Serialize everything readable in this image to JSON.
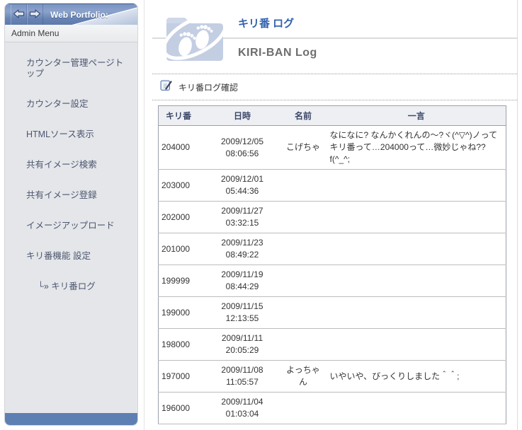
{
  "sidebar": {
    "title": "Web Portfolio:",
    "section_label": "Admin Menu",
    "back_icon": "back-arrow-icon",
    "forward_icon": "forward-arrow-icon",
    "items": [
      {
        "label": "カウンター管理ページトップ",
        "sub": false
      },
      {
        "label": "カウンター設定",
        "sub": false
      },
      {
        "label": "HTMLソース表示",
        "sub": false
      },
      {
        "label": "共有イメージ検索",
        "sub": false
      },
      {
        "label": "共有イメージ登録",
        "sub": false
      },
      {
        "label": "イメージアップロード",
        "sub": false
      },
      {
        "label": "キリ番機能 設定",
        "sub": false
      },
      {
        "label": "キリ番ログ",
        "sub": true,
        "prefix": "└» "
      }
    ]
  },
  "header": {
    "title_jp": "キリ番 ログ",
    "title_en": "KIRI-BAN Log",
    "icon": "footprints-folder-icon"
  },
  "section": {
    "label": "キリ番ログ確認",
    "icon": "log-note-icon"
  },
  "table": {
    "columns": [
      "キリ番",
      "日時",
      "名前",
      "一言"
    ],
    "rows": [
      {
        "kiriban": "204000",
        "date": "2009/12/05",
        "time": "08:06:56",
        "name": "こげちゃ",
        "comment": "なになに? なんかくれんの〜?ヾ(^▽^)ノってキリ番って…204000って…微妙じゃね??f(^_^;"
      },
      {
        "kiriban": "203000",
        "date": "2009/12/01",
        "time": "05:44:36",
        "name": "",
        "comment": ""
      },
      {
        "kiriban": "202000",
        "date": "2009/11/27",
        "time": "03:32:15",
        "name": "",
        "comment": ""
      },
      {
        "kiriban": "201000",
        "date": "2009/11/23",
        "time": "08:49:22",
        "name": "",
        "comment": ""
      },
      {
        "kiriban": "199999",
        "date": "2009/11/19",
        "time": "08:44:29",
        "name": "",
        "comment": ""
      },
      {
        "kiriban": "199000",
        "date": "2009/11/15",
        "time": "12:13:55",
        "name": "",
        "comment": ""
      },
      {
        "kiriban": "198000",
        "date": "2009/11/11",
        "time": "20:05:29",
        "name": "",
        "comment": ""
      },
      {
        "kiriban": "197000",
        "date": "2009/11/08",
        "time": "11:05:57",
        "name": "よっちゃん",
        "comment": "いやいや、びっくりしました＾＾;"
      },
      {
        "kiriban": "196000",
        "date": "2009/11/04",
        "time": "01:03:04",
        "name": "",
        "comment": ""
      }
    ]
  },
  "colors": {
    "header_blue": "#6884b4",
    "footer_blue": "#5e7fb2",
    "sidebar_bg": "#e4e6e9",
    "title_blue": "#3363ae",
    "title_gray": "#6e6e6e",
    "table_header_bg": "#edeff3",
    "table_header_text": "#3c4668",
    "folder_icon_fill": "#c3cee3"
  }
}
